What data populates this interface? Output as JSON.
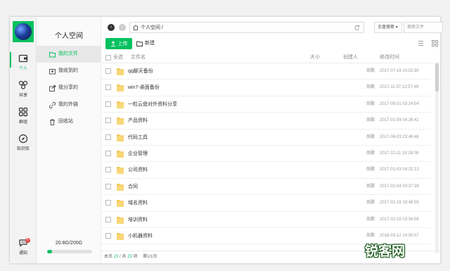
{
  "nav": {
    "items": [
      {
        "label": "个人",
        "icon": "wallet-icon",
        "active": true
      },
      {
        "label": "共享",
        "icon": "share-icon",
        "active": false
      },
      {
        "label": "群组",
        "icon": "group-icon",
        "active": false
      },
      {
        "label": "知识库",
        "icon": "compass-icon",
        "active": false
      }
    ],
    "notice_label": "通知",
    "notice_count": "6"
  },
  "sidebar": {
    "title": "个人空间",
    "items": [
      {
        "label": "我的文件",
        "icon": "folder-icon",
        "active": true
      },
      {
        "label": "我收到的",
        "icon": "inbox-icon"
      },
      {
        "label": "我分享的",
        "icon": "share-out-icon"
      },
      {
        "label": "我的外链",
        "icon": "link-icon"
      },
      {
        "label": "回收站",
        "icon": "trash-icon"
      }
    ],
    "quota_text": "20.8G/200G",
    "quota_fraction": 0.104
  },
  "topbar": {
    "path": "个人空间 /",
    "scope": "全盘搜索 ▾",
    "search_placeholder": "搜索文件"
  },
  "toolbar": {
    "upload_label": "上传",
    "new_label": "新建"
  },
  "table": {
    "select_all": "全选",
    "col_name": "文件名",
    "col_size": "大小",
    "col_creator": "创建人",
    "col_mtime": "修改时间",
    "rows": [
      {
        "name": "qq聊天备份",
        "creator": "尚歌",
        "mtime": "2017-07-19 14:02:30"
      },
      {
        "name": "win7-桌面备份",
        "creator": "尚歌",
        "mtime": "2017-11-07 13:57:49"
      },
      {
        "name": "一粒云盘对外资料分享",
        "creator": "尚歌",
        "mtime": "2017-05-31 03:24:04"
      },
      {
        "name": "产品资料",
        "creator": "尚歌",
        "mtime": "2017-01-09 04:26:41"
      },
      {
        "name": "代码工具",
        "creator": "尚歌",
        "mtime": "2017-06-03 23:48:46"
      },
      {
        "name": "企业管理",
        "creator": "尚歌",
        "mtime": "2017-12-11 18:28:08"
      },
      {
        "name": "公司资料",
        "creator": "尚歌",
        "mtime": "2017-01-03 04:22:13"
      },
      {
        "name": "合同",
        "creator": "尚歌",
        "mtime": "2017-01-04 03:37:38"
      },
      {
        "name": "域名资料",
        "creator": "尚歌",
        "mtime": "2017-02-19 19:48:55"
      },
      {
        "name": "培训资料",
        "creator": "尚歌",
        "mtime": "2017-02-15 03:34:08"
      },
      {
        "name": "小机器资料",
        "creator": "尚歌",
        "mtime": "2016-03-12 14:00:07"
      }
    ]
  },
  "footer": {
    "prefix": "本页",
    "page_count": "23",
    "middle": "/ 共",
    "total": "23",
    "suffix": "项",
    "page_info": "第1/1页"
  },
  "watermark": {
    "text": "锐客网"
  }
}
